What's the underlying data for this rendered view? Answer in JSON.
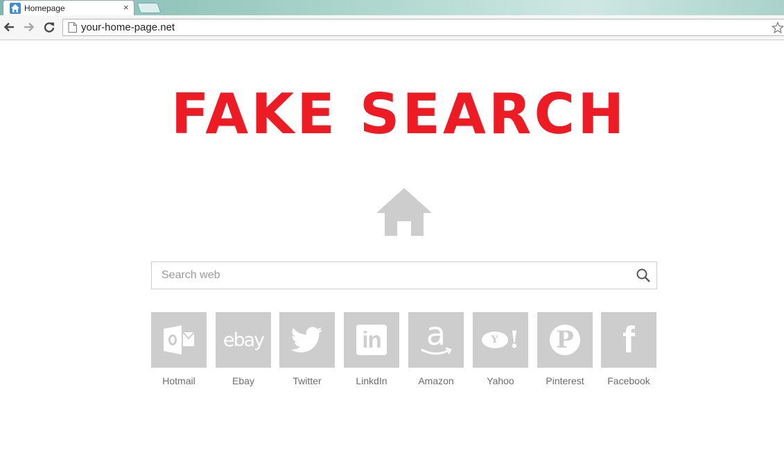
{
  "browser": {
    "tab_title": "Homepage",
    "tab_close": "×",
    "url": "your-home-page.net"
  },
  "page": {
    "headline": "FAKE SEARCH",
    "headline_color": "#ed1c24",
    "logo_icon": "house-icon",
    "search_placeholder": "Search web",
    "search_icon": "magnifier-icon"
  },
  "shortcuts": [
    {
      "label": "Hotmail",
      "icon": "outlook-icon"
    },
    {
      "label": "Ebay",
      "icon": "ebay-icon",
      "logo_text": "ebay"
    },
    {
      "label": "Twitter",
      "icon": "twitter-icon"
    },
    {
      "label": "LinkdIn",
      "icon": "linkedin-icon",
      "logo_text": "in"
    },
    {
      "label": "Amazon",
      "icon": "amazon-icon",
      "logo_text": "a"
    },
    {
      "label": "Yahoo",
      "icon": "yahoo-icon",
      "logo_text": "Y!"
    },
    {
      "label": "Pinterest",
      "icon": "pinterest-icon",
      "logo_text": "P"
    },
    {
      "label": "Facebook",
      "icon": "facebook-icon",
      "logo_text": "f"
    }
  ]
}
